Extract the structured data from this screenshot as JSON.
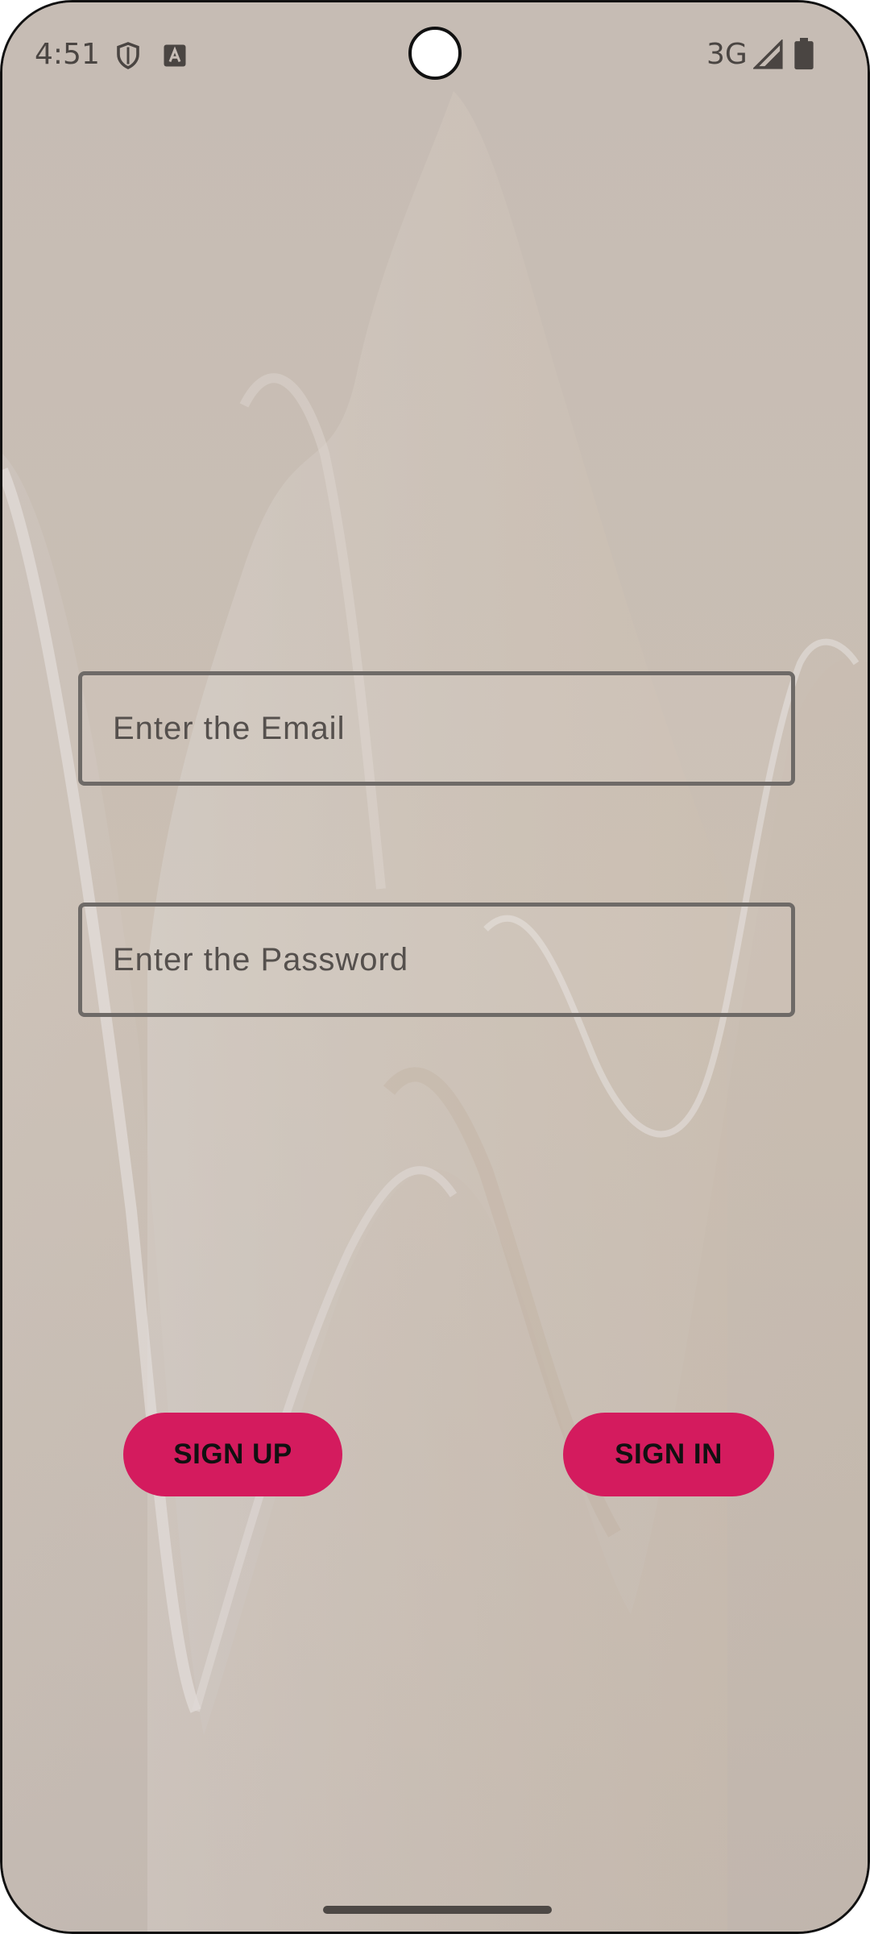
{
  "status_bar": {
    "time": "4:51",
    "network": "3G",
    "icons": [
      "shield-icon",
      "font-a-icon",
      "signal-icon",
      "battery-icon"
    ]
  },
  "form": {
    "email_placeholder": "Enter the Email",
    "email_value": "",
    "password_placeholder": "Enter the Password",
    "password_value": ""
  },
  "buttons": {
    "signup_label": "SIGN UP",
    "signin_label": "SIGN IN"
  },
  "colors": {
    "accent": "#d41b5e",
    "background": "#c7bdb6",
    "field_border": "#6e6a67"
  }
}
